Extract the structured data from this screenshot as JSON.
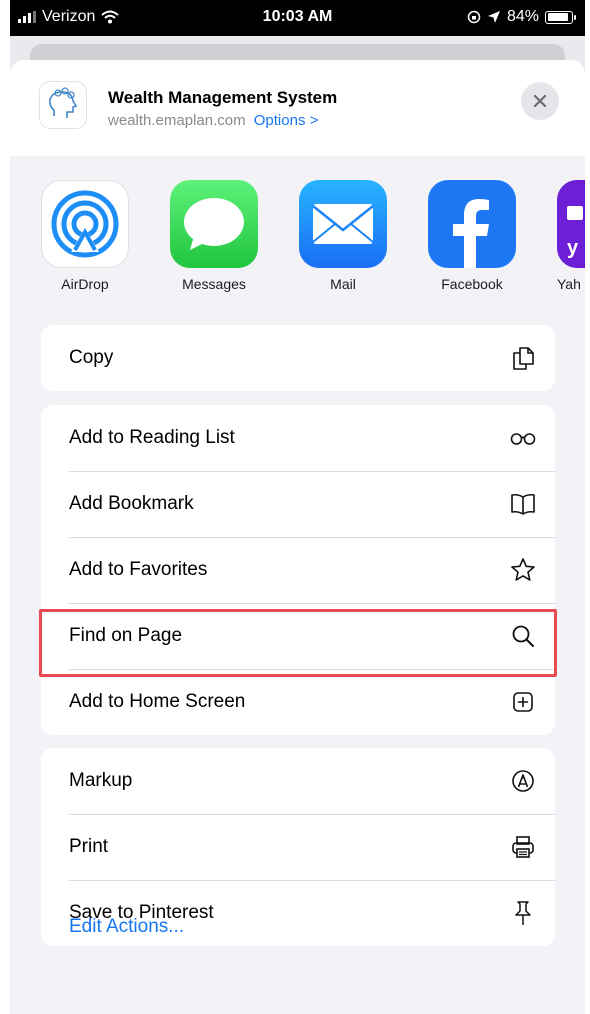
{
  "status_bar": {
    "carrier": "Verizon",
    "time": "10:03 AM",
    "battery": "84%"
  },
  "header": {
    "title": "Wealth Management System",
    "domain": "wealth.emaplan.com",
    "options_label": "Options >"
  },
  "apps": [
    {
      "label": "AirDrop",
      "icon": "airdrop-icon"
    },
    {
      "label": "Messages",
      "icon": "messages-icon"
    },
    {
      "label": "Mail",
      "icon": "mail-icon"
    },
    {
      "label": "Facebook",
      "icon": "facebook-icon"
    },
    {
      "label": "Yah",
      "icon": "yahoo-icon"
    }
  ],
  "actions": {
    "group1": [
      {
        "label": "Copy",
        "icon": "copy-icon"
      }
    ],
    "group2": [
      {
        "label": "Add to Reading List",
        "icon": "glasses-icon"
      },
      {
        "label": "Add Bookmark",
        "icon": "book-icon"
      },
      {
        "label": "Add to Favorites",
        "icon": "star-icon"
      },
      {
        "label": "Find on Page",
        "icon": "search-icon"
      },
      {
        "label": "Add to Home Screen",
        "icon": "plus-square-icon",
        "highlighted": true
      }
    ],
    "group3": [
      {
        "label": "Markup",
        "icon": "markup-icon"
      },
      {
        "label": "Print",
        "icon": "printer-icon"
      },
      {
        "label": "Save to Pinterest",
        "icon": "pin-icon"
      }
    ]
  },
  "edit_actions_label": "Edit Actions...",
  "colors": {
    "accent": "#1476f0",
    "highlight": "#e84b52",
    "sheet": "#f2f2f7"
  }
}
